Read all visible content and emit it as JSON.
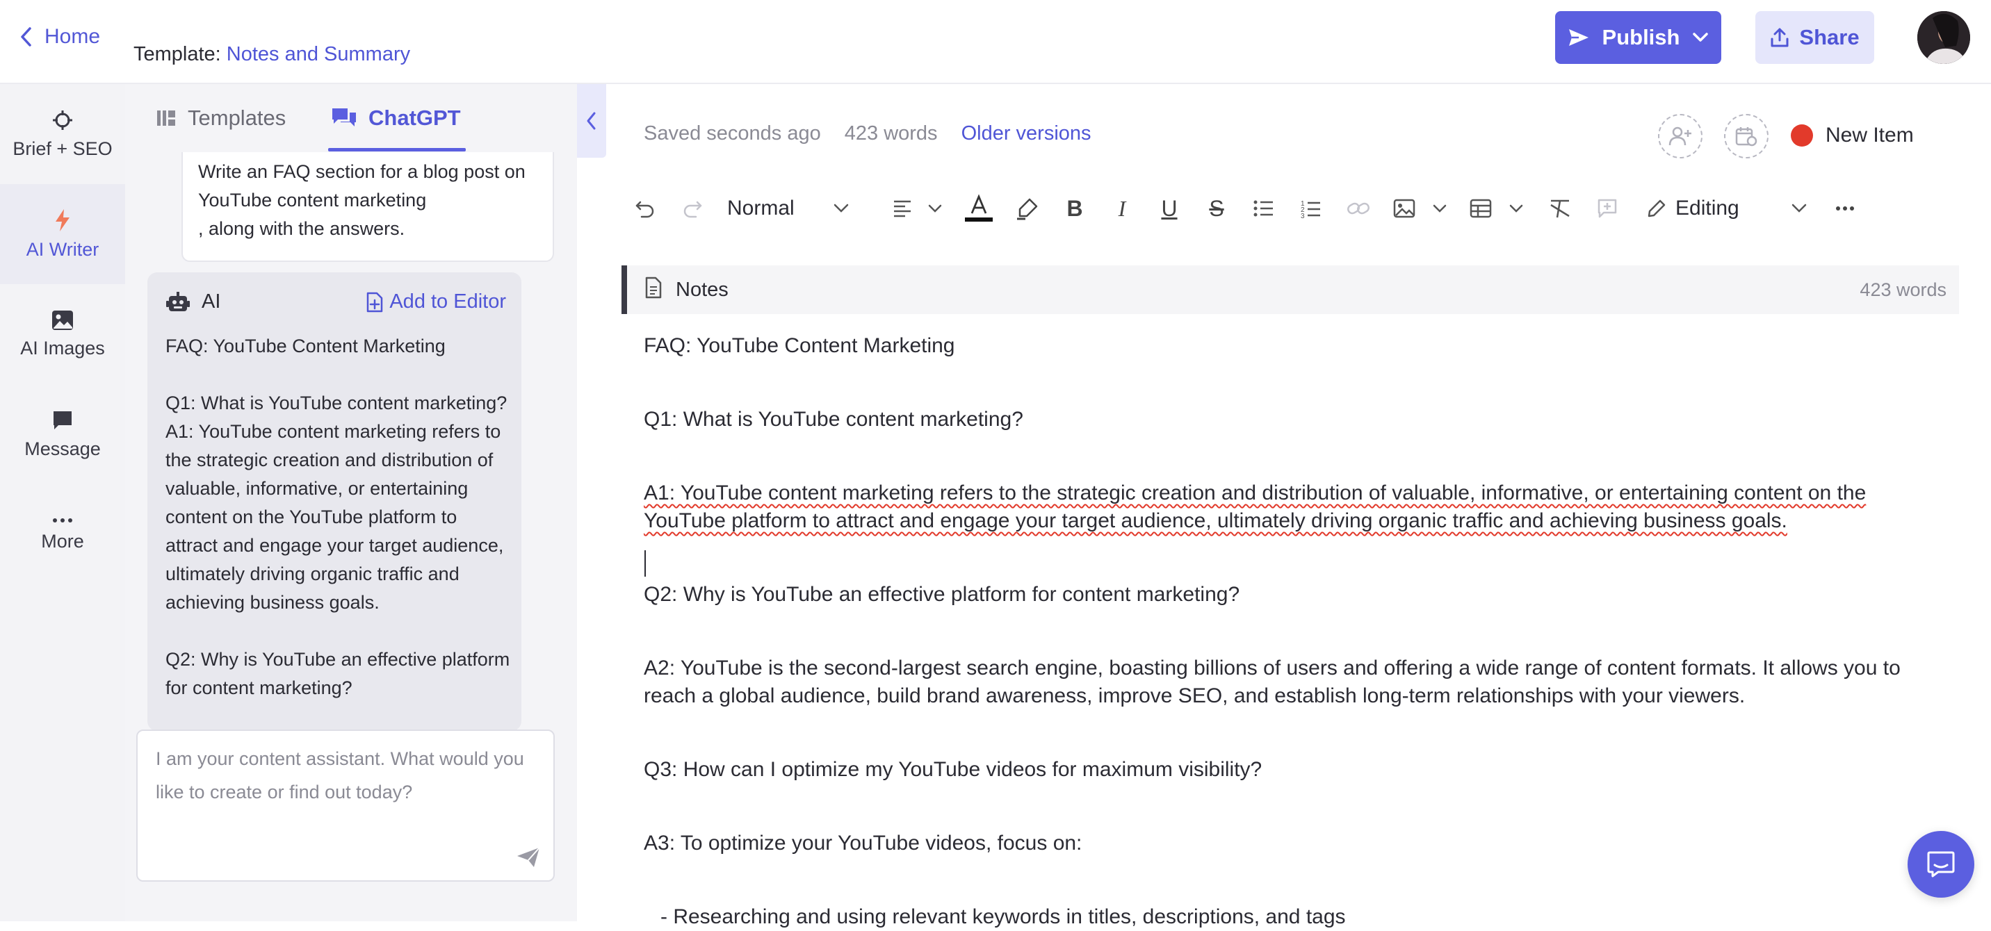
{
  "header": {
    "home_label": "Home",
    "template_prefix": "Template: ",
    "template_name": "Notes and Summary",
    "publish_label": "Publish",
    "share_label": "Share"
  },
  "left_rail": {
    "items": [
      {
        "label": "Brief + SEO",
        "icon": "crosshair-icon"
      },
      {
        "label": "AI Writer",
        "icon": "lightning-icon"
      },
      {
        "label": "AI Images",
        "icon": "image-icon"
      },
      {
        "label": "Message",
        "icon": "chat-icon"
      },
      {
        "label": "More",
        "icon": "more-dots-icon"
      }
    ]
  },
  "chat": {
    "tabs": [
      {
        "label": "Templates",
        "icon": "templates-icon"
      },
      {
        "label": "ChatGPT",
        "icon": "chat-bubbles-icon"
      }
    ],
    "user_message": "Write an FAQ section for a blog post on YouTube content marketing\n, along with the answers.",
    "ai_label": "AI",
    "add_to_editor": "Add to Editor",
    "ai_message": "FAQ: YouTube Content Marketing\n\nQ1: What is YouTube content marketing?\nA1: YouTube content marketing refers to the strategic creation and distribution of valuable, informative, or entertaining content on the YouTube platform to attract and engage your target audience, ultimately driving organic traffic and achieving business goals.\n\nQ2: Why is YouTube an effective platform for content marketing?",
    "input_placeholder": "I am your content assistant. What would you like to create or find out today?"
  },
  "editor": {
    "saved_status": "Saved seconds ago",
    "word_count": "423 words",
    "older_versions": "Older versions",
    "new_item": "New Item",
    "status_color": "#e23a2b",
    "toolbar": {
      "style_select": "Normal",
      "mode": "Editing"
    },
    "notes_title": "Notes",
    "notes_words": "423 words",
    "paragraphs": [
      "FAQ: YouTube Content Marketing",
      "Q1: What is YouTube content marketing?",
      "A1: YouTube content marketing refers to the strategic creation and distribution of valuable, informative, or entertaining content on the YouTube platform to attract and engage your target audience, ultimately driving organic traffic and achieving business goals.",
      "Q2: Why is YouTube an effective platform for content marketing?",
      "A2: YouTube is the second-largest search engine, boasting billions of users and offering a wide range of content formats. It allows you to reach a global audience, build brand awareness, improve SEO, and establish long-term relationships with your viewers.",
      "Q3: How can I optimize my YouTube videos for maximum visibility?",
      "A3: To optimize your YouTube videos, focus on:",
      "- Researching and using relevant keywords in titles, descriptions, and tags"
    ]
  },
  "colors": {
    "accent": "#5b5fe0",
    "accent_text": "#4f55d6",
    "rail_bg": "#f3f3f6"
  }
}
